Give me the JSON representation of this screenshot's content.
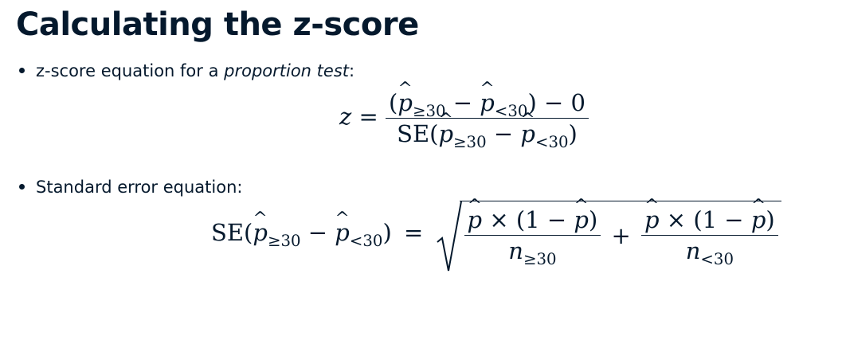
{
  "slide": {
    "title": "Calculating the z-score"
  },
  "bullets": [
    {
      "text_before": "z-score equation for a ",
      "text_em": "proportion test",
      "text_after": ":"
    },
    {
      "text_before": "Standard error equation:",
      "text_em": "",
      "text_after": ""
    }
  ],
  "eq1": {
    "lhs": "z",
    "eq": "=",
    "num_open": "(",
    "p": "p",
    "sub_ge": "≥30",
    "minus": " − ",
    "sub_lt": "<30",
    "num_close": ") − 0",
    "den_prefix": "SE(",
    "den_close": ")"
  },
  "eq2": {
    "lhs_prefix": "SE(",
    "p": "p",
    "sub_ge": "≥30",
    "minus": " − ",
    "sub_lt": "<30",
    "lhs_close": ")",
    "eq": "=",
    "num_text": " × (1 − ",
    "num_close": ")",
    "n": "n",
    "plus": "+"
  },
  "colors": {
    "text": "#05192d",
    "background": "#ffffff"
  }
}
